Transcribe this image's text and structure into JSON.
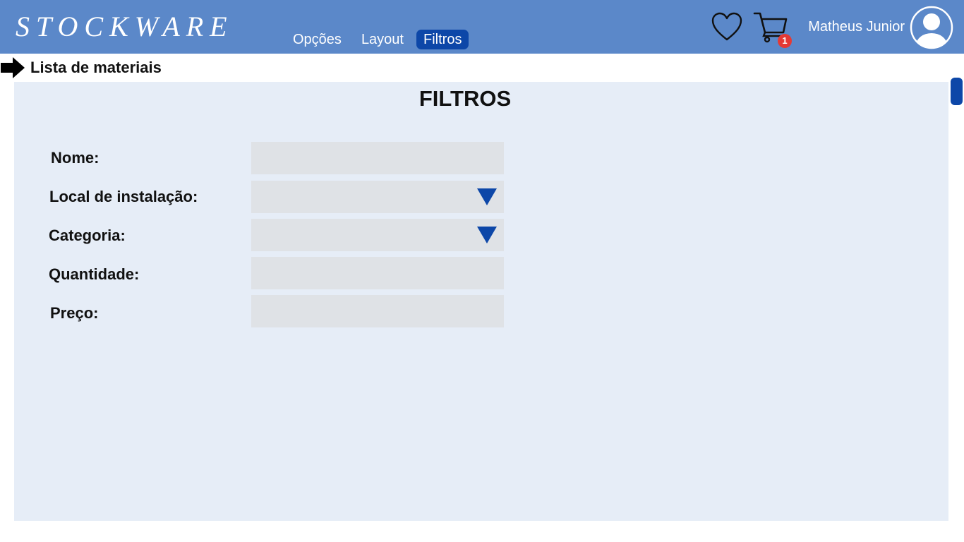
{
  "header": {
    "brand": "STOCKWARE",
    "nav": [
      {
        "label": "Opções",
        "active": false
      },
      {
        "label": "Layout",
        "active": false
      },
      {
        "label": "Filtros",
        "active": true
      }
    ],
    "cart_count": "1",
    "user_name": "Matheus Junior",
    "icons": [
      "heart-icon",
      "cart-icon",
      "avatar-icon"
    ]
  },
  "breadcrumb": {
    "icon": "arrow-right-icon",
    "label": "Lista de materiais"
  },
  "filters": {
    "title": "FILTROS",
    "fields": [
      {
        "label": "Nome:",
        "type": "text",
        "value": ""
      },
      {
        "label": "Local de instalação:",
        "type": "select",
        "value": ""
      },
      {
        "label": "Categoria:",
        "type": "select",
        "value": ""
      },
      {
        "label": "Quantidade:",
        "type": "text",
        "value": ""
      },
      {
        "label": "Preço:",
        "type": "text",
        "value": ""
      }
    ]
  },
  "colors": {
    "topbar": "#5b88c9",
    "accent": "#0d47a8",
    "panel": "#e6edf7",
    "field": "#dfe2e6",
    "badge": "#e53935"
  }
}
